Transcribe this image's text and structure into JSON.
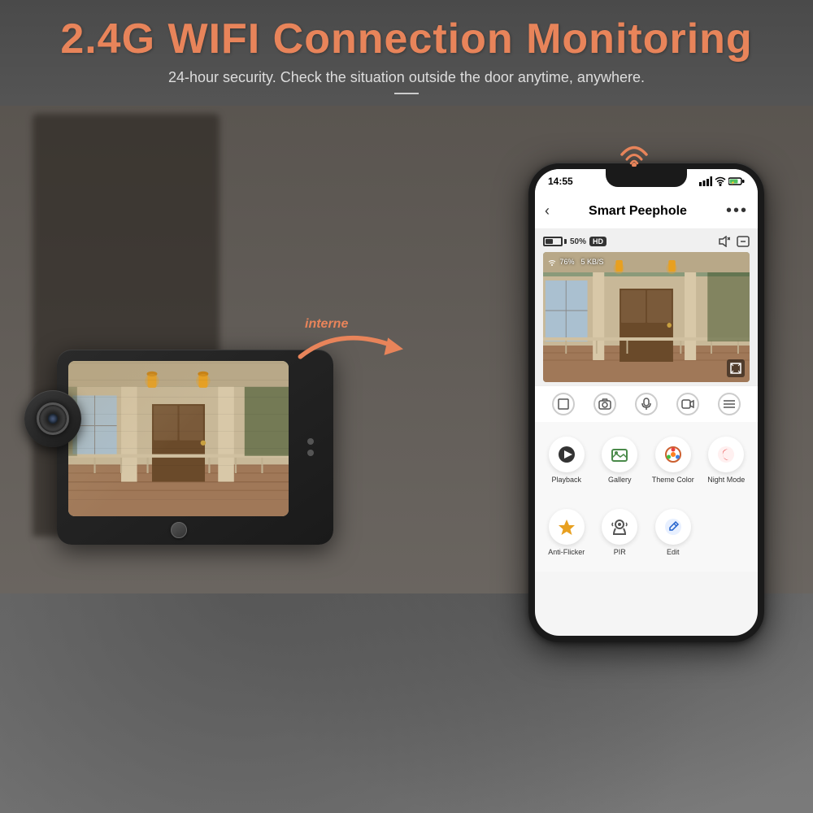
{
  "header": {
    "main_title": "2.4G WIFI Connection Monitoring",
    "sub_title": "24-hour security. Check the situation outside the door anytime, anywhere."
  },
  "arrow_label": "interne",
  "app": {
    "status_bar": {
      "time": "14:55",
      "battery": "50%",
      "quality": "HD",
      "wifi_signal": "76%",
      "data_speed": "5 KB/S"
    },
    "title": "Smart Peephole",
    "back_icon": "‹",
    "menu_icon": "•••",
    "controls": [
      {
        "icon": "⛶",
        "label": ""
      },
      {
        "icon": "⊙",
        "label": ""
      },
      {
        "icon": "⋮",
        "label": ""
      },
      {
        "icon": "▷",
        "label": ""
      },
      {
        "icon": "≡",
        "label": ""
      }
    ],
    "features_row1": [
      {
        "label": "Playback",
        "icon_type": "playback"
      },
      {
        "label": "Gallery",
        "icon_type": "gallery"
      },
      {
        "label": "Theme Color",
        "icon_type": "theme"
      },
      {
        "label": "Night Mode",
        "icon_type": "night"
      }
    ],
    "features_row2": [
      {
        "label": "Anti-Flicker",
        "icon_type": "flicker"
      },
      {
        "label": "PIR",
        "icon_type": "pir"
      },
      {
        "label": "Edit",
        "icon_type": "edit"
      },
      {
        "label": "",
        "icon_type": "empty"
      }
    ]
  }
}
